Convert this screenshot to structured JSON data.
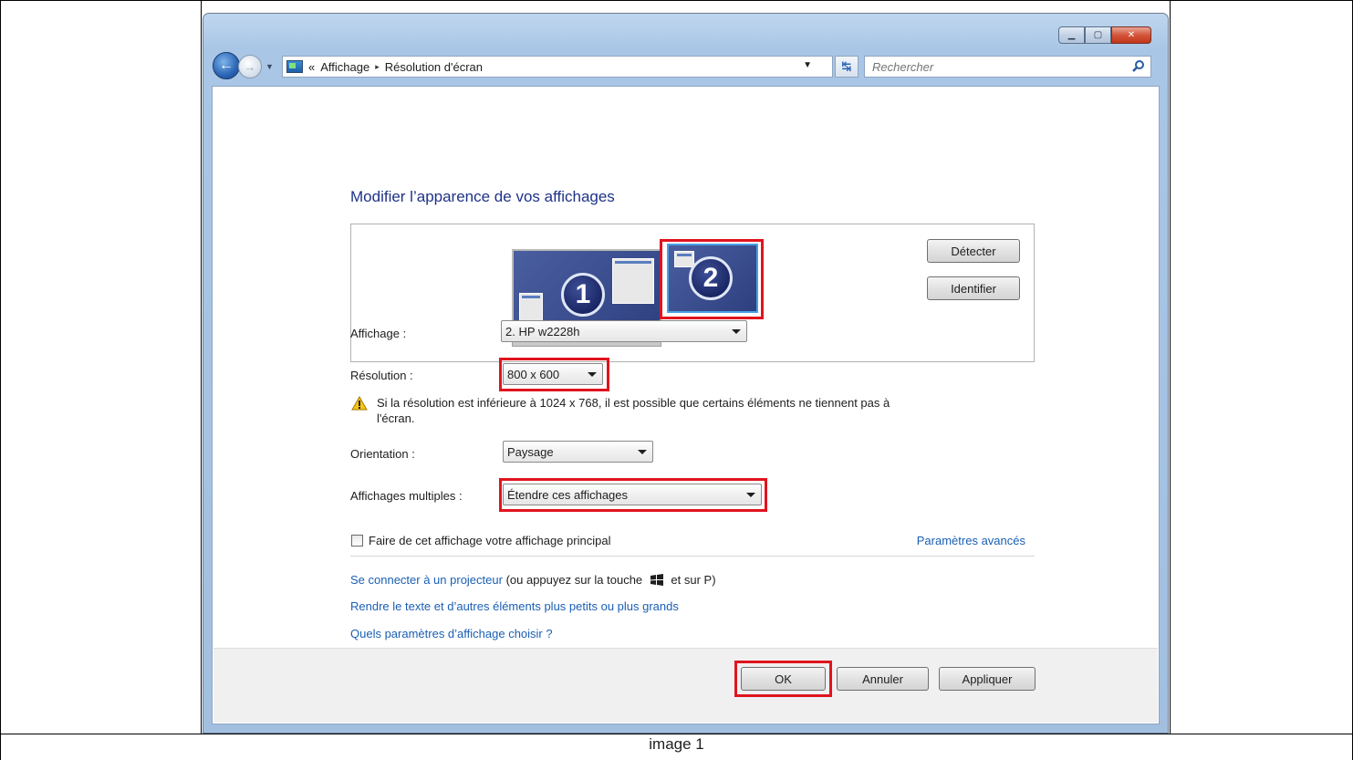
{
  "window": {
    "caption_buttons": {
      "minimize": "minimize-icon",
      "maximize": "maximize-icon",
      "close": "close-icon"
    }
  },
  "addressbar": {
    "prefix": "«",
    "crumb1": "Affichage",
    "separator": "▸",
    "crumb2": "Résolution d'écran",
    "search_placeholder": "Rechercher"
  },
  "page": {
    "title": "Modifier l’apparence de vos affichages"
  },
  "monitors": {
    "monitor1": "1",
    "monitor2": "2"
  },
  "buttons": {
    "detect": "Détecter",
    "identify": "Identifier",
    "ok": "OK",
    "cancel": "Annuler",
    "apply": "Appliquer"
  },
  "fields": {
    "display_label": "Affichage :",
    "display_value": "2. HP w2228h",
    "resolution_label": "Résolution :",
    "resolution_value": "800 x 600",
    "warning_line1": "Si la résolution est inférieure à 1024 x 768, il est possible que certains éléments ne tiennent pas à",
    "warning_line2": "l'écran.",
    "orientation_label": "Orientation :",
    "orientation_value": "Paysage",
    "multiple_label": "Affichages multiples :",
    "multiple_value": "Étendre ces affichages"
  },
  "options": {
    "primary_checkbox_label": "Faire de cet affichage votre affichage principal",
    "primary_checked": false,
    "advanced_link": "Paramètres avancés"
  },
  "links": {
    "projector_link": "Se connecter à un projecteur",
    "projector_hint_before": "(ou appuyez sur la touche",
    "projector_hint_after": "et sur P)",
    "text_size_link": "Rendre le texte et d’autres éléments plus petits ou plus grands",
    "which_settings_link": "Quels paramètres d’affichage choisir ?"
  },
  "highlight_color": "#e0141e",
  "document_caption": "image 1"
}
